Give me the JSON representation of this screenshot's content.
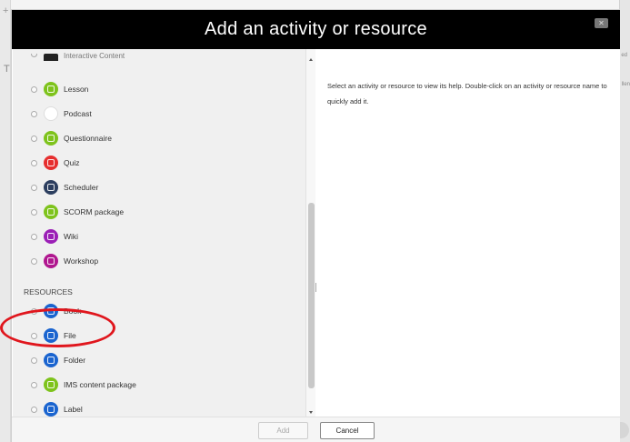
{
  "dialog": {
    "title": "Add an activity or resource"
  },
  "options": {
    "partial_top_label": "Interactive Content",
    "activities": [
      {
        "label": "Lesson",
        "icon": "lesson-icon",
        "color": "#7ec31c"
      },
      {
        "label": "Podcast",
        "icon": "podcast-icon",
        "color": "#ffffff"
      },
      {
        "label": "Questionnaire",
        "icon": "questionnaire-icon",
        "color": "#7ec31c"
      },
      {
        "label": "Quiz",
        "icon": "quiz-icon",
        "color": "#e62f2f"
      },
      {
        "label": "Scheduler",
        "icon": "scheduler-icon",
        "color": "#2c3e5f"
      },
      {
        "label": "SCORM package",
        "icon": "scorm-icon",
        "color": "#7ec31c"
      },
      {
        "label": "Wiki",
        "icon": "wiki-icon",
        "color": "#9b1fb6"
      },
      {
        "label": "Workshop",
        "icon": "workshop-icon",
        "color": "#b0178f"
      }
    ],
    "resources_heading": "RESOURCES",
    "resources": [
      {
        "label": "Book",
        "icon": "book-icon",
        "color": "#1a64cf"
      },
      {
        "label": "File",
        "icon": "file-icon",
        "color": "#1a64cf"
      },
      {
        "label": "Folder",
        "icon": "folder-icon",
        "color": "#1a64cf"
      },
      {
        "label": "IMS content package",
        "icon": "ims-package-icon",
        "color": "#7ec31c"
      },
      {
        "label": "Label",
        "icon": "label-icon",
        "color": "#1a64cf"
      }
    ]
  },
  "help": {
    "text": "Select an activity or resource to view its help. Double-click on an activity or resource name to quickly add it."
  },
  "footer": {
    "add_label": "Add",
    "cancel_label": "Cancel"
  },
  "background": {
    "right_snippet_1": "ed",
    "right_snippet_2": "llen"
  },
  "colors": {
    "header": "#000000",
    "highlight": "#e0161d",
    "panel": "#f0f0f0"
  }
}
